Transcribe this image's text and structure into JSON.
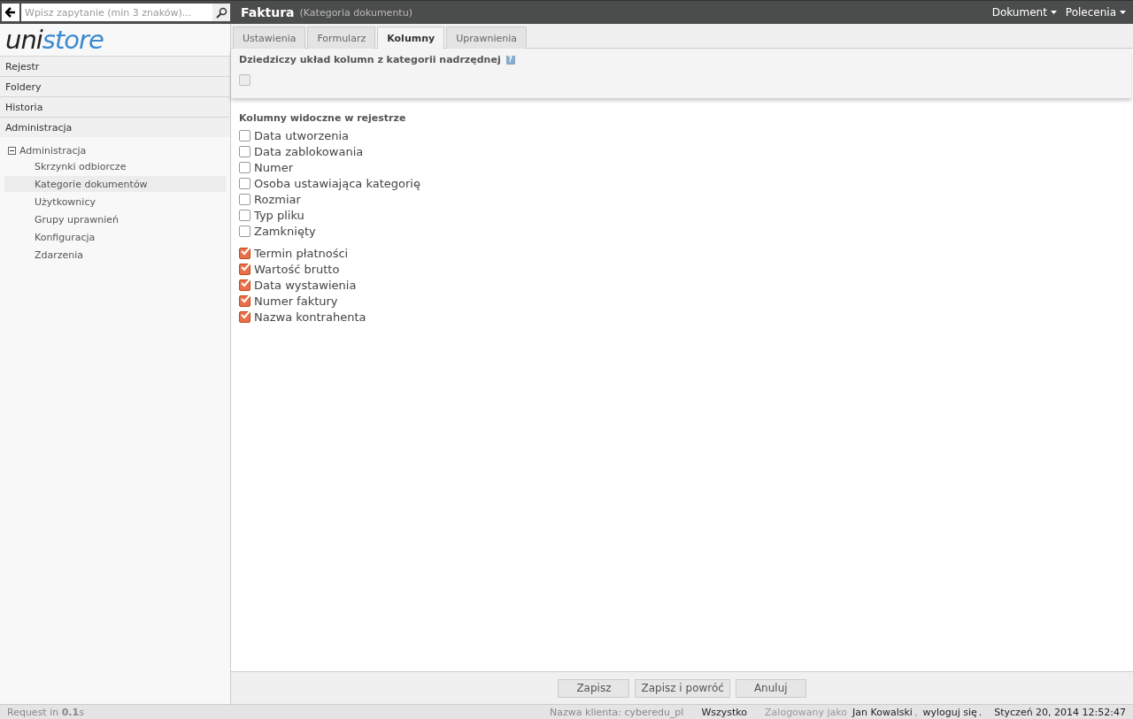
{
  "search": {
    "placeholder": "Wpisz zapytanie (min 3 znaków)..."
  },
  "header": {
    "title": "Faktura",
    "subtitle": "(Kategoria dokumentu)",
    "menus": [
      "Dokument",
      "Polecenia"
    ]
  },
  "logo": {
    "dark": "uni",
    "blue": "store"
  },
  "sidebar": {
    "sections": [
      {
        "label": "Rejestr"
      },
      {
        "label": "Foldery"
      },
      {
        "label": "Historia"
      },
      {
        "label": "Administracja"
      }
    ],
    "tree": {
      "label": "Administracja",
      "expanded": true,
      "children": [
        {
          "label": "Skrzynki odbiorcze",
          "selected": false
        },
        {
          "label": "Kategorie dokumentów",
          "selected": true
        },
        {
          "label": "Użytkownicy",
          "selected": false
        },
        {
          "label": "Grupy uprawnień",
          "selected": false
        },
        {
          "label": "Konfiguracja",
          "selected": false
        },
        {
          "label": "Zdarzenia",
          "selected": false
        }
      ]
    }
  },
  "tabs": [
    {
      "label": "Ustawienia",
      "selected": false
    },
    {
      "label": "Formularz",
      "selected": false
    },
    {
      "label": "Kolumny",
      "selected": true
    },
    {
      "label": "Uprawnienia",
      "selected": false
    }
  ],
  "inherit": {
    "label": "Dziedziczy układ kolumn z kategorii nadrzędnej",
    "help": "?",
    "checked": false,
    "disabled": true
  },
  "columns": {
    "title": "Kolumny widoczne w rejestrze",
    "groups": [
      [
        {
          "label": "Data utworzenia",
          "checked": false
        },
        {
          "label": "Data zablokowania",
          "checked": false
        },
        {
          "label": "Numer",
          "checked": false
        },
        {
          "label": "Osoba ustawiająca kategorię",
          "checked": false
        },
        {
          "label": "Rozmiar",
          "checked": false
        },
        {
          "label": "Typ pliku",
          "checked": false
        },
        {
          "label": "Zamknięty",
          "checked": false
        }
      ],
      [
        {
          "label": "Termin płatności",
          "checked": true
        },
        {
          "label": "Wartość brutto",
          "checked": true
        },
        {
          "label": "Data wystawienia",
          "checked": true
        },
        {
          "label": "Numer faktury",
          "checked": true
        },
        {
          "label": "Nazwa kontrahenta",
          "checked": true
        }
      ]
    ]
  },
  "buttons": [
    "Zapisz",
    "Zapisz i powróć",
    "Anuluj"
  ],
  "status_bar": {
    "request": "Request in **0.1**s",
    "client": "Nazwa klienta: cyberedu_pl",
    "scope": "Wszystko",
    "login": [
      {
        "text": "Zalogowany jako",
        "kind": "muted"
      },
      {
        "text": "Jan Kowalski",
        "kind": "strong"
      },
      {
        "text": ",",
        "kind": "muted"
      },
      {
        "text": "wyloguj się",
        "kind": "link"
      },
      {
        "text": ".",
        "kind": "strong"
      }
    ],
    "datetime": "Styczeń 20, 2014 12:52:47"
  }
}
